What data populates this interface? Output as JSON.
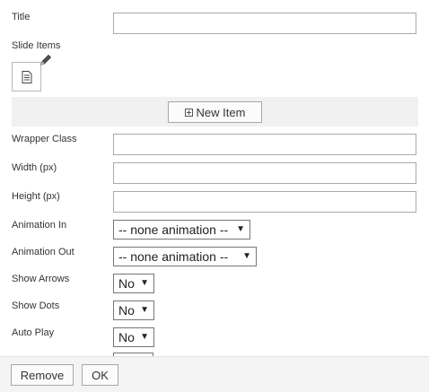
{
  "fields": {
    "title_label": "Title",
    "slide_items_label": "Slide Items",
    "wrapper_class_label": "Wrapper Class",
    "width_label": "Width (px)",
    "height_label": "Height (px)",
    "animation_in_label": "Animation In",
    "animation_in_value": "-- none animation --",
    "animation_out_label": "Animation Out",
    "animation_out_value": "-- none animation --",
    "show_arrows_label": "Show Arrows",
    "show_arrows_value": "No",
    "show_dots_label": "Show Dots",
    "show_dots_value": "No",
    "auto_play_label": "Auto Play",
    "auto_play_value": "No"
  },
  "slide_items": {
    "new_item_label": "New Item"
  },
  "footer": {
    "remove_label": "Remove",
    "ok_label": "OK"
  },
  "icons": {
    "slide_thumbnail": "document-icon",
    "edit": "pencil-icon",
    "new_item": "plus-square-icon",
    "dropdown": "caret-down-icon"
  }
}
